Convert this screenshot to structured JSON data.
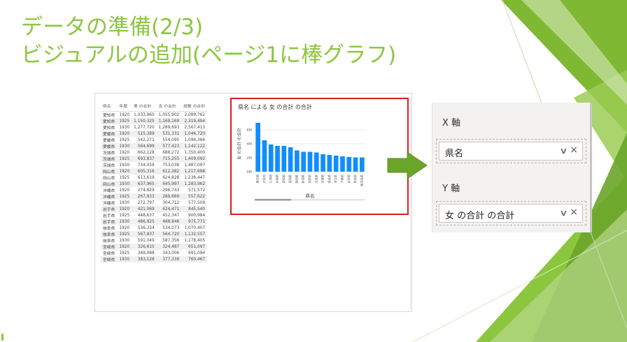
{
  "slide": {
    "title_line1": "データの準備(2/3)",
    "title_line2": "ビジュアルの追加(ページ1に棒グラフ)"
  },
  "table": {
    "headers": [
      "県名",
      "年度",
      "男 の合計",
      "女 の合計",
      "総数 の合計"
    ],
    "rows": [
      [
        "愛知県",
        "1920",
        "1,033,860",
        "1,055,902",
        "2,089,762"
      ],
      [
        "愛知県",
        "1925",
        "1,150,325",
        "1,169,169",
        "2,319,494"
      ],
      [
        "愛知県",
        "1930",
        "1,277,720",
        "1,289,693",
        "2,567,413"
      ],
      [
        "愛媛県",
        "1920",
        "515,389",
        "531,331",
        "1,046,720"
      ],
      [
        "愛媛県",
        "1925",
        "542,271",
        "554,095",
        "1,096,366"
      ],
      [
        "愛媛県",
        "1930",
        "564,699",
        "577,423",
        "1,142,122"
      ],
      [
        "茨城県",
        "1920",
        "662,128",
        "688,272",
        "1,350,400"
      ],
      [
        "茨城県",
        "1925",
        "693,837",
        "715,255",
        "1,409,092"
      ],
      [
        "茨城県",
        "1930",
        "734,059",
        "753,038",
        "1,487,097"
      ],
      [
        "岡山県",
        "1920",
        "605,316",
        "612,382",
        "1,217,698"
      ],
      [
        "岡山県",
        "1925",
        "613,619",
        "624,828",
        "1,238,447"
      ],
      [
        "岡山県",
        "1930",
        "637,965",
        "645,997",
        "1,283,962"
      ],
      [
        "沖縄県",
        "1920",
        "274,829",
        "296,743",
        "571,572"
      ],
      [
        "沖縄県",
        "1925",
        "267,933",
        "289,689",
        "557,622"
      ],
      [
        "沖縄県",
        "1930",
        "272,797",
        "304,712",
        "577,509"
      ],
      [
        "岩手県",
        "1920",
        "421,069",
        "424,471",
        "845,540"
      ],
      [
        "岩手県",
        "1925",
        "448,637",
        "452,347",
        "900,984"
      ],
      [
        "岩手県",
        "1930",
        "486,925",
        "488,846",
        "975,771"
      ],
      [
        "岐阜県",
        "1920",
        "536,334",
        "534,073",
        "1,070,407"
      ],
      [
        "岐阜県",
        "1925",
        "567,837",
        "564,720",
        "1,132,557"
      ],
      [
        "岐阜県",
        "1930",
        "591,049",
        "587,356",
        "1,178,405"
      ],
      [
        "宮崎県",
        "1920",
        "326,610",
        "324,487",
        "651,097"
      ],
      [
        "宮崎県",
        "1925",
        "348,088",
        "343,006",
        "691,094"
      ],
      [
        "宮崎県",
        "1930",
        "383,128",
        "377,339",
        "760,467"
      ]
    ]
  },
  "chart_data": {
    "type": "bar",
    "title": "県名 による 女 の合計 の合計",
    "xlabel": "県名",
    "ylabel": "女 の合計 の合計",
    "ylim": [
      0,
      8
    ],
    "yticks": [
      "0M",
      "2M",
      "4M",
      "6M"
    ],
    "yticks_values": [
      0,
      2,
      4,
      6
    ],
    "categories": [
      "東京都",
      "大阪府",
      "北海道",
      "兵庫県",
      "愛知県",
      "福岡県",
      "静岡県",
      "新潟県",
      "長野県",
      "広島県",
      "茨城県",
      "福島県",
      "埼玉県",
      "千葉県",
      "岐阜県",
      "熊本県",
      "鹿児島県"
    ],
    "values": [
      7.0,
      4.5,
      3.9,
      3.7,
      3.7,
      3.5,
      3.05,
      2.85,
      2.85,
      2.75,
      2.5,
      2.4,
      2.3,
      2.2,
      2.1,
      2.05,
      2.05
    ],
    "bar_color": "#118dff"
  },
  "pane": {
    "x_axis_title": "X 軸",
    "x_field": "県名",
    "y_axis_title": "Y 軸",
    "y_field": "女 の合計 の合計",
    "chevron": "∨",
    "remove": "×"
  },
  "colors": {
    "title_green": "#8cc63f",
    "accent_red": "#d61f1f",
    "arrow_green": "#6aa52a"
  },
  "icons": {
    "arrow": "right-arrow-icon",
    "chevron": "chevron-down-icon",
    "remove": "close-icon"
  }
}
